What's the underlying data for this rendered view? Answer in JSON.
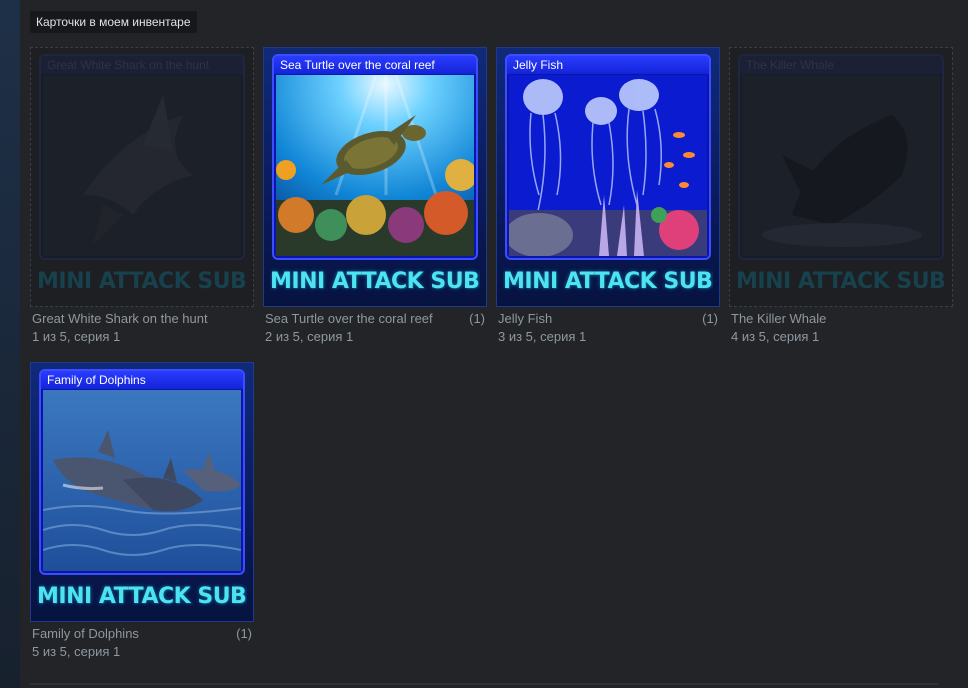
{
  "section": {
    "title": "Карточки в моем инвентаре"
  },
  "cards": [
    {
      "title": "Great White Shark on the hunt",
      "brand": "MINI ATTACK SUBMARINE",
      "name": "Great White Shark on the hunt",
      "count": "",
      "series": "1 из 5, серия 1",
      "owned": false
    },
    {
      "title": "Sea Turtle over the coral reef",
      "brand": "MINI ATTACK SUBMARINE",
      "name": "Sea Turtle over the coral reef",
      "count": "(1)",
      "series": "2 из 5, серия 1",
      "owned": true
    },
    {
      "title": "Jelly Fish",
      "brand": "MINI ATTACK SUBMARINE",
      "name": "Jelly Fish",
      "count": "(1)",
      "series": "3 из 5, серия 1",
      "owned": true
    },
    {
      "title": "The Killer Whale",
      "brand": "MINI ATTACK SUBMARINE",
      "name": "The Killer Whale",
      "count": "",
      "series": "4 из 5, серия 1",
      "owned": false
    },
    {
      "title": "Family of Dolphins",
      "brand": "MINI ATTACK SUBMARINE",
      "name": "Family of Dolphins",
      "count": "(1)",
      "series": "5 из 5, серия 1",
      "owned": true
    }
  ]
}
